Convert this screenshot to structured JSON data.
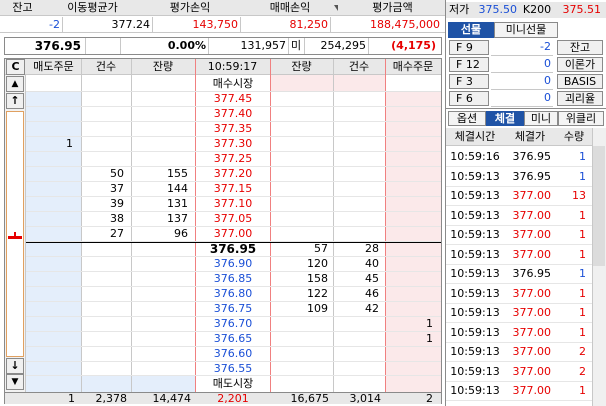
{
  "position": {
    "headers": [
      "잔고",
      "이동평균가",
      "평가손익",
      "매매손익",
      "평가금액"
    ],
    "values": [
      "-2",
      "377.24",
      "143,750",
      "81,250",
      "188,475,000"
    ]
  },
  "quote_bar": {
    "price": "376.95",
    "change_pct": "0.00%",
    "volume": "131,957",
    "oi_label": "미",
    "open_interest": "254,295",
    "oi_change": "(4,175)"
  },
  "order_book": {
    "headers": {
      "c": "C",
      "sell_order": "매도주문",
      "count_left": "건수",
      "qty_left": "잔량",
      "time": "10:59:17",
      "qty_right": "잔량",
      "count_right": "건수",
      "buy_order": "매수주문"
    },
    "buy_market_label": "매수시장",
    "sell_market_label": "매도시장",
    "ask_rows": [
      {
        "price": "377.45",
        "qty": "",
        "cnt": "",
        "sell": ""
      },
      {
        "price": "377.40",
        "qty": "",
        "cnt": "",
        "sell": ""
      },
      {
        "price": "377.35",
        "qty": "",
        "cnt": "",
        "sell": ""
      },
      {
        "price": "377.30",
        "qty": "",
        "cnt": "",
        "sell": "1"
      },
      {
        "price": "377.25",
        "qty": "",
        "cnt": "",
        "sell": ""
      },
      {
        "price": "377.20",
        "qty": "155",
        "cnt": "50",
        "sell": ""
      },
      {
        "price": "377.15",
        "qty": "144",
        "cnt": "37",
        "sell": ""
      },
      {
        "price": "377.10",
        "qty": "131",
        "cnt": "39",
        "sell": ""
      },
      {
        "price": "377.05",
        "qty": "137",
        "cnt": "38",
        "sell": ""
      },
      {
        "price": "377.00",
        "qty": "96",
        "cnt": "27",
        "sell": ""
      }
    ],
    "current": {
      "price": "376.95",
      "qty": "57",
      "cnt": "28"
    },
    "bid_rows": [
      {
        "price": "376.90",
        "qty": "120",
        "cnt": "40",
        "buy": ""
      },
      {
        "price": "376.85",
        "qty": "158",
        "cnt": "45",
        "buy": ""
      },
      {
        "price": "376.80",
        "qty": "122",
        "cnt": "46",
        "buy": ""
      },
      {
        "price": "376.75",
        "qty": "109",
        "cnt": "42",
        "buy": ""
      },
      {
        "price": "376.70",
        "qty": "",
        "cnt": "",
        "buy": "1"
      },
      {
        "price": "376.65",
        "qty": "",
        "cnt": "",
        "buy": "1"
      },
      {
        "price": "376.60",
        "qty": "",
        "cnt": "",
        "buy": ""
      },
      {
        "price": "376.55",
        "qty": "",
        "cnt": "",
        "buy": ""
      }
    ],
    "totals": {
      "sell_order": "1",
      "count_left": "2,378",
      "qty_left": "14,474",
      "diff": "2,201",
      "qty_right": "16,675",
      "count_right": "3,014",
      "buy_order": "2"
    }
  },
  "right_panel": {
    "low_label": "저가",
    "low_value": "375.50",
    "k200_label": "K200",
    "k200_value": "375.51",
    "tabs": [
      "선물",
      "미니선물"
    ],
    "fkeys": [
      {
        "key": "F 9",
        "value": "-2",
        "action": "잔고"
      },
      {
        "key": "F 12",
        "value": "0",
        "action": "이론가"
      },
      {
        "key": "F 3",
        "value": "0",
        "action": "BASIS"
      },
      {
        "key": "F 6",
        "value": "0",
        "action": "괴리율"
      }
    ],
    "sub_tabs": [
      "옵션",
      "체결",
      "미니",
      "위클리"
    ],
    "trades_headers": [
      "체결시간",
      "체결가",
      "수량"
    ],
    "trades": [
      {
        "time": "10:59:16",
        "price": "376.95",
        "qty": "1",
        "side": "sell"
      },
      {
        "time": "10:59:13",
        "price": "376.95",
        "qty": "1",
        "side": "sell"
      },
      {
        "time": "10:59:13",
        "price": "377.00",
        "qty": "13",
        "side": "buy"
      },
      {
        "time": "10:59:13",
        "price": "377.00",
        "qty": "1",
        "side": "buy"
      },
      {
        "time": "10:59:13",
        "price": "377.00",
        "qty": "1",
        "side": "buy"
      },
      {
        "time": "10:59:13",
        "price": "377.00",
        "qty": "1",
        "side": "buy"
      },
      {
        "time": "10:59:13",
        "price": "376.95",
        "qty": "1",
        "side": "sell"
      },
      {
        "time": "10:59:13",
        "price": "377.00",
        "qty": "1",
        "side": "buy"
      },
      {
        "time": "10:59:13",
        "price": "377.00",
        "qty": "1",
        "side": "buy"
      },
      {
        "time": "10:59:13",
        "price": "377.00",
        "qty": "1",
        "side": "buy"
      },
      {
        "time": "10:59:13",
        "price": "377.00",
        "qty": "2",
        "side": "buy"
      },
      {
        "time": "10:59:13",
        "price": "377.00",
        "qty": "2",
        "side": "buy"
      },
      {
        "time": "10:59:13",
        "price": "377.00",
        "qty": "1",
        "side": "buy"
      }
    ]
  },
  "scroll": {
    "up": "▲",
    "down": "▼",
    "up2": "↑",
    "down2": "↓"
  },
  "colors": {
    "ask": "#e60000",
    "bid": "#1a4fd6",
    "sell_bg": "#e4eefb",
    "buy_bg": "#fbe9ea",
    "tab_active": "#1f53a6"
  }
}
